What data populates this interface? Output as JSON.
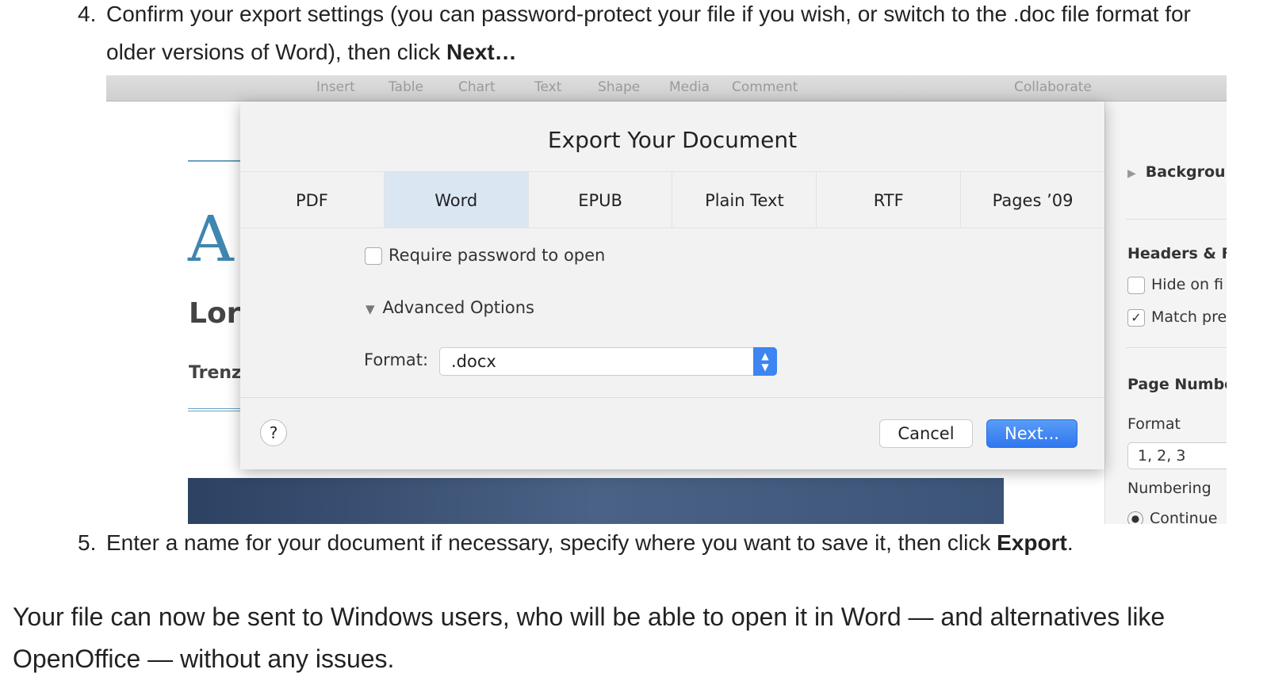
{
  "steps": [
    {
      "num": "4.",
      "text_before": "Confirm your export settings (you can password-protect your file if you wish, or switch to the .doc file format for older versions of Word), then click ",
      "bold": "Next…",
      "text_after": ""
    },
    {
      "num": "5.",
      "text_before": "Enter a name for your document if necessary, specify where you want to save it, then click ",
      "bold": "Export",
      "text_after": "."
    }
  ],
  "screenshot": {
    "toolbar": [
      "Insert",
      "Table",
      "Chart",
      "Text",
      "Shape",
      "Media",
      "Comment",
      "Collaborate"
    ],
    "document": {
      "drop_cap": "A",
      "heading": "Lor",
      "subheading": "Trenz"
    },
    "sidebar": {
      "background": "Backgrou",
      "headers": "Headers & F",
      "hide": "Hide on fi",
      "match": "Match pre",
      "page_numbers": "Page Numbe",
      "format_label": "Format",
      "format_value": "1, 2, 3",
      "numbering": "Numbering",
      "continue": "Continue"
    },
    "dialog": {
      "title": "Export Your Document",
      "tabs": [
        "PDF",
        "Word",
        "EPUB",
        "Plain Text",
        "RTF",
        "Pages ’09"
      ],
      "selected_tab": "Word",
      "password_label": "Require password to open",
      "password_checked": false,
      "advanced_label": "Advanced Options",
      "format_label": "Format:",
      "format_value": ".docx",
      "help": "?",
      "cancel": "Cancel",
      "next": "Next...",
      "accent": "#3d85f0"
    }
  },
  "paragraph": "Your file can now be sent to Windows users, who will be able to open it in Word — and alternatives like OpenOffice — without any issues."
}
